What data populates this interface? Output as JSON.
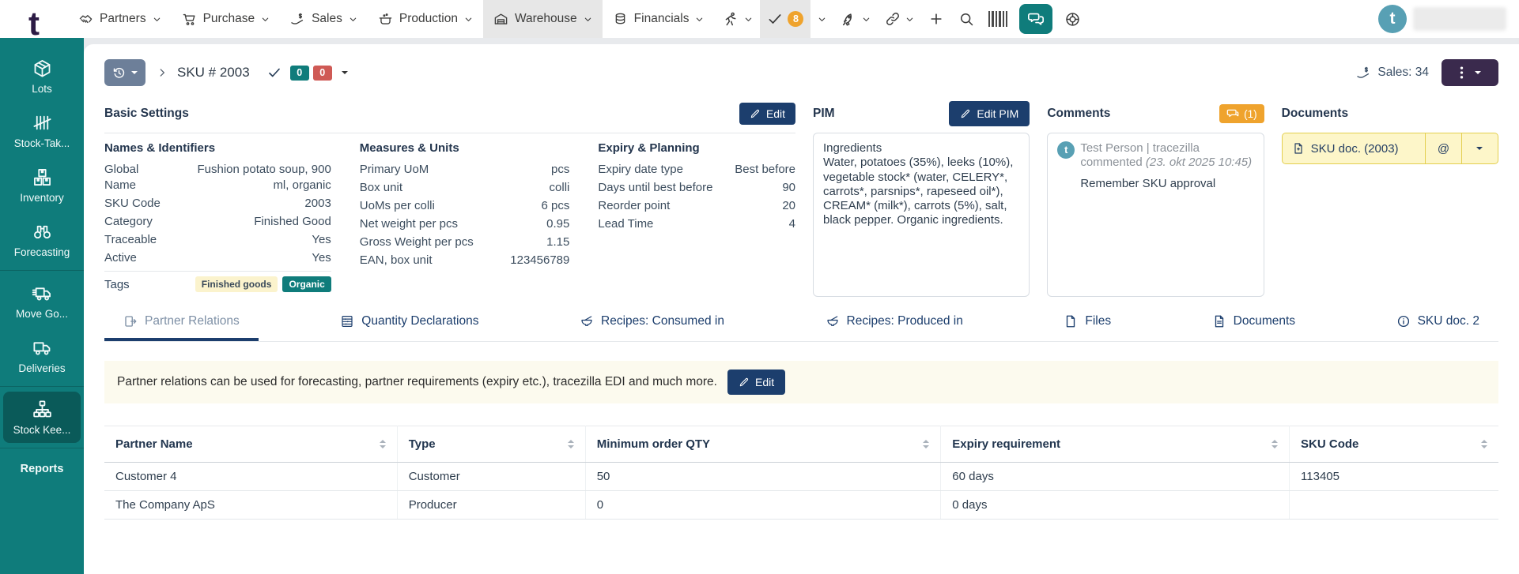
{
  "topnav": {
    "logo": "t",
    "menus": [
      {
        "label": "Partners"
      },
      {
        "label": "Purchase"
      },
      {
        "label": "Sales"
      },
      {
        "label": "Production"
      },
      {
        "label": "Warehouse",
        "active": true
      },
      {
        "label": "Financials"
      }
    ],
    "tasks_badge": "8",
    "avatar_letter": "t"
  },
  "sidebar": {
    "items": [
      {
        "label": "Lots"
      },
      {
        "label": "Stock-Tak..."
      },
      {
        "label": "Inventory"
      },
      {
        "label": "Forecasting"
      },
      {
        "label": "Move Go..."
      },
      {
        "label": "Deliveries"
      },
      {
        "label": "Stock Kee...",
        "active": true
      }
    ],
    "reports_label": "Reports"
  },
  "page_header": {
    "title": "SKU # 2003",
    "badge_teal": "0",
    "badge_red": "0",
    "sales_label": "Sales: 34"
  },
  "basic_settings": {
    "title": "Basic Settings",
    "edit_label": "Edit",
    "columns": [
      {
        "title": "Names & Identifiers",
        "rows": [
          {
            "label": "Global Name",
            "value": "Fushion potato soup, 900 ml, organic"
          },
          {
            "label": "SKU Code",
            "value": "2003"
          },
          {
            "label": "Category",
            "value": "Finished Good"
          },
          {
            "label": "Traceable",
            "value": "Yes"
          },
          {
            "label": "Active",
            "value": "Yes"
          }
        ],
        "tags_label": "Tags",
        "tags": [
          {
            "label": "Finished goods",
            "style": "yellow"
          },
          {
            "label": "Organic",
            "style": "teal"
          }
        ]
      },
      {
        "title": "Measures & Units",
        "rows": [
          {
            "label": "Primary UoM",
            "value": "pcs"
          },
          {
            "label": "Box unit",
            "value": "colli"
          },
          {
            "label": "UoMs per colli",
            "value": "6 pcs"
          },
          {
            "label": "Net weight per pcs",
            "value": "0.95"
          },
          {
            "label": "Gross Weight per pcs",
            "value": "1.15"
          },
          {
            "label": "EAN, box unit",
            "value": "123456789"
          }
        ]
      },
      {
        "title": "Expiry & Planning",
        "rows": [
          {
            "label": "Expiry date type",
            "value": "Best before"
          },
          {
            "label": "Days until best before",
            "value": "90"
          },
          {
            "label": "Reorder point",
            "value": "20"
          },
          {
            "label": "Lead Time",
            "value": "4"
          }
        ]
      }
    ]
  },
  "pim": {
    "title": "PIM",
    "edit_label": "Edit PIM",
    "line1": "Ingredients",
    "body": "Water, potatoes (35%), leeks (10%), vegetable stock* (water, CELERY*, carrots*, parsnips*, rapeseed oil*), CREAM* (milk*), carrots (5%), salt, black pepper. Organic ingredients."
  },
  "comments": {
    "title": "Comments",
    "badge": "(1)",
    "avatar_letter": "t",
    "author": "Test Person | tracezilla",
    "action": "commented",
    "timestamp": "(23. okt 2025 10:45)",
    "body": "Remember SKU approval"
  },
  "documents": {
    "title": "Documents",
    "doc_label": "SKU doc. (2003)",
    "at_label": "@"
  },
  "tabs": [
    {
      "label": "Partner Relations",
      "active": true
    },
    {
      "label": "Quantity Declarations"
    },
    {
      "label": "Recipes: Consumed in"
    },
    {
      "label": "Recipes: Produced in"
    },
    {
      "label": "Files"
    },
    {
      "label": "Documents"
    },
    {
      "label": "SKU doc. 2"
    }
  ],
  "info_bar": {
    "text": "Partner relations can be used for forecasting, partner requirements (expiry etc.), tracezilla EDI and much more.",
    "edit_label": "Edit"
  },
  "table": {
    "headers": [
      "Partner Name",
      "Type",
      "Minimum order QTY",
      "Expiry requirement",
      "SKU Code"
    ],
    "rows": [
      [
        "Customer 4",
        "Customer",
        "50",
        "60 days",
        "113405"
      ],
      [
        "The Company ApS",
        "Producer",
        "0",
        "0 days",
        ""
      ]
    ]
  },
  "colors": {
    "teal": "#0f7c7b",
    "sidebar_active": "#0a5a59",
    "navy": "#1c3e6d",
    "orange_badge": "#efa32d",
    "red_badge": "#cf5a55",
    "history_button": "#6d7f99",
    "more_button_purple": "#3a2a4d",
    "avatar_teal": "#58a0b4",
    "tag_yellow_bg": "#fbf3cd",
    "doc_button_bg": "#fdf6c9",
    "doc_button_border": "#e3cf4f",
    "info_bar_bg": "#fcfaee"
  }
}
